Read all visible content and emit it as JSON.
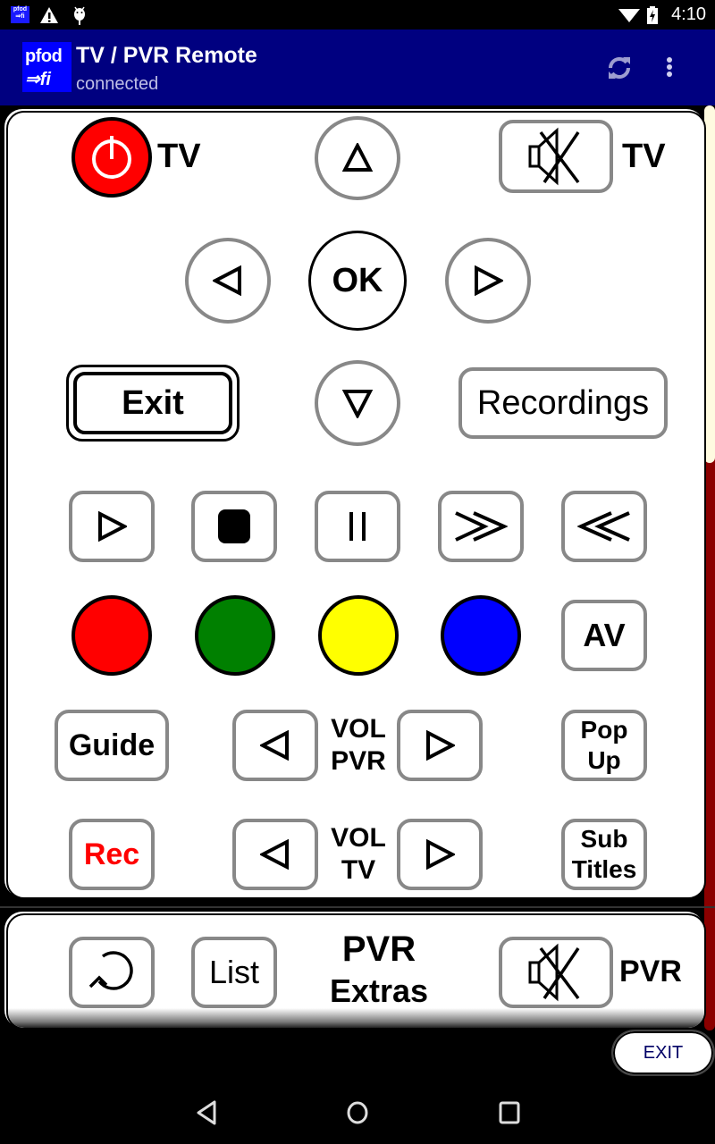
{
  "status_bar": {
    "app_icon_text": [
      "pfod",
      "⇒fi"
    ],
    "time": "4:10",
    "icons": [
      "app-notification-icon",
      "warning-icon",
      "android-debug-icon",
      "wifi-icon",
      "battery-charging-icon"
    ]
  },
  "action_bar": {
    "logo_line1": "pfod",
    "logo_line2": "⇒fi",
    "title": "TV / PVR Remote",
    "subtitle": "connected",
    "background_color": "#000080",
    "actions": [
      "refresh-icon",
      "overflow-menu-icon"
    ]
  },
  "remote": {
    "power_tv_label": "TV",
    "mute_tv_label": "TV",
    "ok_label": "OK",
    "exit_label": "Exit",
    "recordings_label": "Recordings",
    "av_label": "AV",
    "guide_label": "Guide",
    "vol_pvr_label": [
      "VOL",
      "PVR"
    ],
    "popup_label": [
      "Pop",
      "Up"
    ],
    "rec_label": "Rec",
    "vol_tv_label": [
      "VOL",
      "TV"
    ],
    "subtitles_label": [
      "Sub",
      "Titles"
    ],
    "color_buttons": [
      {
        "name": "red",
        "color": "#ff0000"
      },
      {
        "name": "green",
        "color": "#008000"
      },
      {
        "name": "yellow",
        "color": "#ffff00"
      },
      {
        "name": "blue",
        "color": "#0000ff"
      }
    ],
    "transport": [
      "play-icon",
      "stop-icon",
      "pause-icon",
      "fast-forward-icon",
      "rewind-icon"
    ],
    "power_color": "#ff0000",
    "rec_color": "#ff0000"
  },
  "extras": {
    "list_label": "List",
    "title_line1": "PVR",
    "title_line2": "Extras",
    "mute_pvr_label": "PVR"
  },
  "exit_button": "EXIT",
  "scrollbar": {
    "thumb_color": "#fffbe0",
    "track_color": "#8b0000"
  },
  "nav_bar": [
    "back-icon",
    "home-icon",
    "recents-icon"
  ]
}
